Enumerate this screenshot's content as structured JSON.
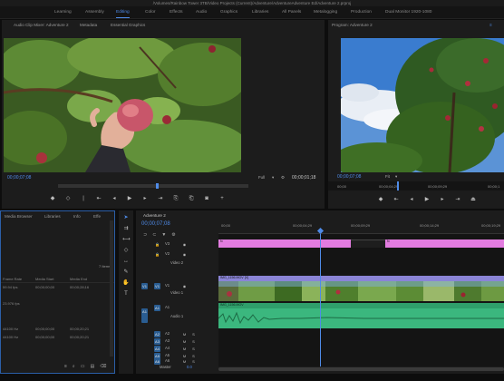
{
  "app": {
    "title": "/Volumes/Rainbow Tower 3TB/Video Projects (Current)/Adventure/AdventureAdventure Ed/Adventure 2.prproj"
  },
  "workspaces": [
    {
      "label": "Learning",
      "active": false
    },
    {
      "label": "Assembly",
      "active": false
    },
    {
      "label": "Editing",
      "active": true
    },
    {
      "label": "Color",
      "active": false
    },
    {
      "label": "Effects",
      "active": false
    },
    {
      "label": "Audio",
      "active": false
    },
    {
      "label": "Graphics",
      "active": false
    },
    {
      "label": "Libraries",
      "active": false
    },
    {
      "label": "All Panels",
      "active": false
    },
    {
      "label": "Metalogging",
      "active": false
    },
    {
      "label": "Production",
      "active": false
    },
    {
      "label": "Dual Monitor 1920-1080",
      "active": false
    }
  ],
  "source": {
    "tabs": [
      "Audio Clip Mixer: Adventure 2",
      "Metadata",
      "Essential Graphics"
    ],
    "timecode_left": "00;00;07;08",
    "fit": "Full",
    "timecode_right": "00;00;01;18"
  },
  "program": {
    "title": "Program: Adventure 2",
    "timecode": "00;00;07;08",
    "fit": "Fit",
    "ruler_labels": [
      "00;00",
      "00;00;04;29",
      "00;00;09;29",
      "00;00;1"
    ]
  },
  "project": {
    "tabs": [
      "Media Browser",
      "Libraries",
      "Info",
      "Effe"
    ],
    "items_count": "7 Items",
    "columns": [
      "Frame Rate",
      "Media Start",
      "Media End"
    ],
    "rows": [
      {
        "rate": "59.94 fps",
        "start": "00;00;00;00",
        "end": "00;00;28;16"
      },
      {
        "rate": "23.976 fps",
        "start": "",
        "end": ""
      },
      {
        "rate": "44100 Hz",
        "start": "00;00;00;00",
        "end": "00;00;20;21"
      },
      {
        "rate": "44100 Hz",
        "start": "00;00;00;00",
        "end": "00;00;20;21"
      }
    ]
  },
  "timeline": {
    "title": "Adventure 2",
    "timecode": "00;00;07;08",
    "ruler_labels": [
      "00;00",
      "00;00;04;29",
      "00;00;09;29",
      "00;00;14;29",
      "00;00;19;29"
    ],
    "tracks": {
      "video": [
        "V3",
        "V2",
        "Video 2",
        "V1",
        "Video 1"
      ],
      "audio": [
        "A1",
        "Audio 1",
        "A2",
        "A3",
        "A4",
        "A5",
        "A6"
      ],
      "master": "Master",
      "master_value": "0.0"
    },
    "fx_label": "fx",
    "clip_label": "IMG_1156.MOV [V]",
    "audio_clip_label": "IMG_1156.MOV"
  },
  "colors": {
    "accent": "#4f8be8",
    "graphic_clip": "#e37ce0",
    "video_clip": "#8a84d6",
    "audio_clip": "#3bb77e",
    "track_toggle": "#2a5d92"
  }
}
